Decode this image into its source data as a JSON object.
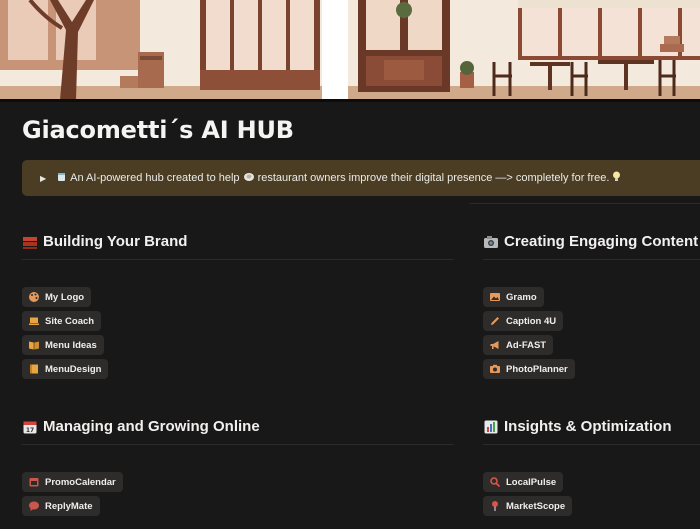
{
  "page": {
    "title": "Giacometti´s AI HUB"
  },
  "callout": {
    "text_a": "An AI-powered hub created to help",
    "text_b": "restaurant owners improve their digital presence —> completely for free."
  },
  "sections": {
    "brand": {
      "title": "Building Your Brand",
      "icon": "bricks-icon",
      "items": [
        {
          "label": "My Logo",
          "icon": "palette-icon"
        },
        {
          "label": "Site Coach",
          "icon": "laptop-icon"
        },
        {
          "label": "Menu Ideas",
          "icon": "book-icon"
        },
        {
          "label": "MenuDesign",
          "icon": "notebook-icon"
        }
      ]
    },
    "content": {
      "title": "Creating Engaging Content",
      "icon": "camera-icon",
      "items": [
        {
          "label": "Gramo",
          "icon": "image-icon"
        },
        {
          "label": "Caption 4U",
          "icon": "pencil-icon"
        },
        {
          "label": "Ad-FAST",
          "icon": "megaphone-icon"
        },
        {
          "label": "PhotoPlanner",
          "icon": "camera-icon"
        }
      ]
    },
    "online": {
      "title": "Managing and Growing Online",
      "icon": "calendar-icon",
      "items": [
        {
          "label": "PromoCalendar",
          "icon": "calendar-icon"
        },
        {
          "label": "ReplyMate",
          "icon": "speech-bubble-icon"
        }
      ]
    },
    "insights": {
      "title": "Insights & Optimization",
      "icon": "bar-chart-icon",
      "items": [
        {
          "label": "LocalPulse",
          "icon": "magnifier-icon"
        },
        {
          "label": "MarketScope",
          "icon": "pin-icon"
        }
      ]
    }
  },
  "colors": {
    "background": "#191818",
    "callout_bg": "#4a3d24",
    "chip_bg": "#2d2c2b",
    "icon_accent": "#e59a5c"
  }
}
